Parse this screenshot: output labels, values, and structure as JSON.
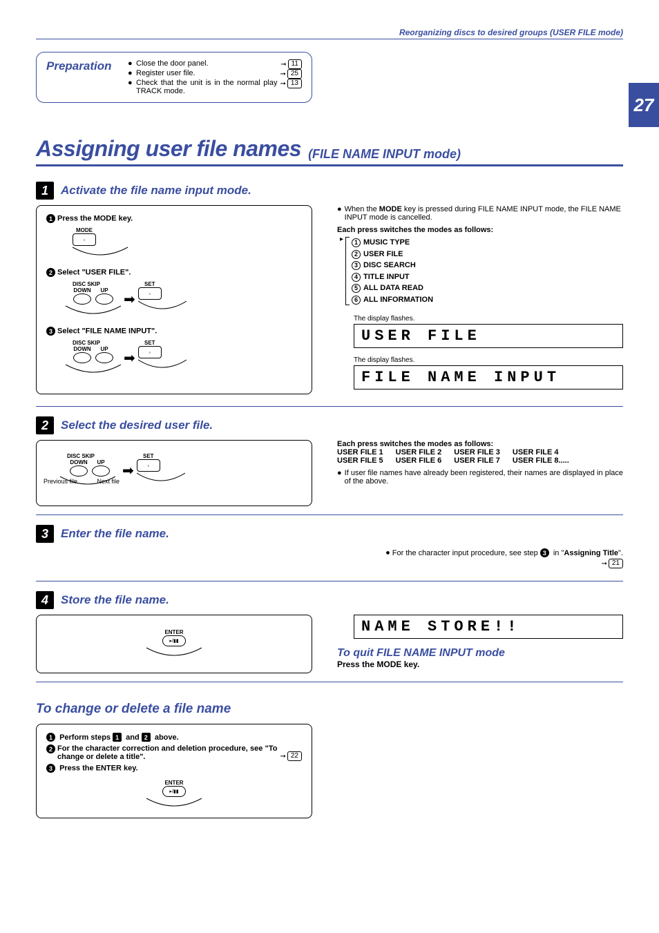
{
  "header": {
    "breadcrumb": "Reorganizing discs to desired groups (USER FILE mode)"
  },
  "page_number": "27",
  "preparation": {
    "label": "Preparation",
    "items": [
      {
        "text": "Close the door panel.",
        "ref": "11"
      },
      {
        "text": "Register user file.",
        "ref": "25"
      },
      {
        "text": "Check that the unit is in the normal play TRACK mode.",
        "ref": "13"
      }
    ]
  },
  "title": {
    "main": "Assigning user file names",
    "sub": "(FILE NAME INPUT mode)"
  },
  "steps": {
    "s1": {
      "title": "Activate the file name input mode.",
      "a": "Press the MODE key.",
      "b": "Select \"USER FILE\".",
      "c": "Select \"FILE NAME INPUT\".",
      "mode_label": "MODE",
      "disc_skip_label": "DISC SKIP",
      "down_label": "DOWN",
      "up_label": "UP",
      "set_label": "SET"
    },
    "s2": {
      "title": "Select the desired user file.",
      "prev": "Previous file",
      "next": "Next file",
      "disc_skip_label": "DISC SKIP",
      "down_label": "DOWN",
      "up_label": "UP",
      "set_label": "SET"
    },
    "s3": {
      "title": "Enter the file name."
    },
    "s4": {
      "title": "Store the file name.",
      "enter_label": "ENTER"
    }
  },
  "right": {
    "note_mode_cancel_pre": "When the ",
    "note_mode_cancel_bold": "MODE",
    "note_mode_cancel_post": " key is pressed during FILE NAME INPUT mode, the FILE NAME INPUT  mode is cancelled.",
    "each_press": "Each press switches the modes as follows:",
    "modes": [
      "MUSIC TYPE",
      "USER FILE",
      "DISC SEARCH",
      "TITLE INPUT",
      "ALL DATA READ",
      "ALL INFORMATION"
    ],
    "flash1": "The display flashes.",
    "lcd1": "USER FILE",
    "flash2": "The display flashes.",
    "lcd2": "FILE NAME INPUT",
    "each_press2": "Each press switches the modes as follows:",
    "user_files_row1": [
      "USER FILE 1",
      "USER FILE 2",
      "USER FILE 3",
      "USER FILE 4"
    ],
    "user_files_row2": [
      "USER FILE 5",
      "USER FILE 6",
      "USER FILE 7",
      "USER FILE 8....."
    ],
    "registered_note": "If user file names have already been registered, their names are displayed in place of the above.",
    "char_input_pre": "For the character input procedure, see step ",
    "char_input_step": "3",
    "char_input_mid": " in \"",
    "char_input_bold": "Assigning Title",
    "char_input_post": "\".",
    "char_input_ref": "21",
    "lcd3": "NAME STORE!!",
    "quit_title": "To quit FILE NAME INPUT mode",
    "quit_action": "Press the MODE key."
  },
  "change": {
    "title": "To change or delete a file name",
    "a_pre": "Perform steps ",
    "a_s1": "1",
    "a_mid": " and ",
    "a_s2": "2",
    "a_post": " above.",
    "b": "For the character correction and deletion procedure, see \"To change or delete a title\".",
    "b_ref": "22",
    "c": "Press the ENTER key.",
    "enter_label": "ENTER"
  }
}
